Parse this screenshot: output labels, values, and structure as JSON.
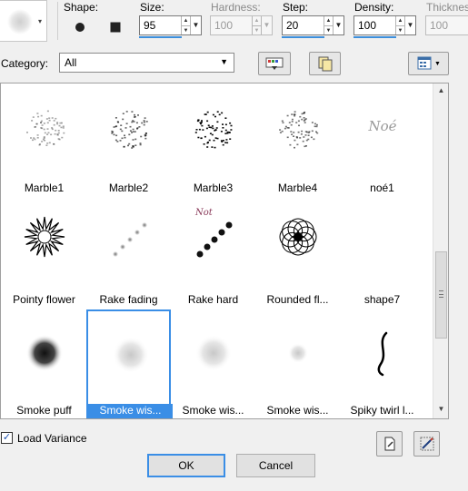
{
  "toolbar": {
    "shape_label": "Shape:",
    "size": {
      "label": "Size:",
      "value": "95"
    },
    "hardness": {
      "label": "Hardness:",
      "value": "100"
    },
    "step": {
      "label": "Step:",
      "value": "20"
    },
    "density": {
      "label": "Density:",
      "value": "100"
    },
    "thickness": {
      "label": "Thicknes",
      "value": "100"
    }
  },
  "category": {
    "label": "Category:",
    "value": "All"
  },
  "brushes": [
    {
      "name": "Marble1",
      "icon": "marble-icon"
    },
    {
      "name": "Marble2",
      "icon": "marble-icon"
    },
    {
      "name": "Marble3",
      "icon": "marble-icon"
    },
    {
      "name": "Marble4",
      "icon": "marble-icon"
    },
    {
      "name": "noé1",
      "icon": "signature-icon"
    },
    {
      "name": "Pointy flower",
      "icon": "pointy-flower-icon"
    },
    {
      "name": "Rake fading",
      "icon": "rake-icon"
    },
    {
      "name": "Rake hard",
      "icon": "rake-icon"
    },
    {
      "name": "Rounded fl...",
      "icon": "rounded-flower-icon"
    },
    {
      "name": "shape7",
      "icon": "crescent-icon"
    },
    {
      "name": "Smoke puff",
      "icon": "smoke-icon"
    },
    {
      "name": "Smoke wis...",
      "icon": "smoke-icon",
      "selected": true
    },
    {
      "name": "Smoke wis...",
      "icon": "smoke-icon"
    },
    {
      "name": "Smoke wis...",
      "icon": "smoke-icon"
    },
    {
      "name": "Spiky twirl l...",
      "icon": "twirl-icon"
    }
  ],
  "load_variance": {
    "label": "Load Variance",
    "checked": true
  },
  "buttons": {
    "ok": "OK",
    "cancel": "Cancel"
  },
  "colors": {
    "selection": "#3a8ee6",
    "accent_underline": "#3c8fdc"
  }
}
